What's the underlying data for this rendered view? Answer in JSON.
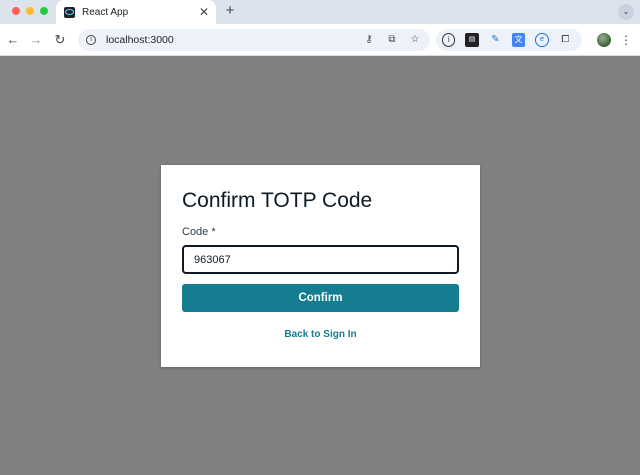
{
  "browser": {
    "tab_title": "React App",
    "tab_close": "✕",
    "new_tab": "+",
    "tab_menu": "⌄",
    "url": "localhost:3000",
    "nav": {
      "back": "←",
      "forward": "→",
      "reload": "↻"
    },
    "omnibox_icons": [
      "key-icon",
      "open-in-app-icon",
      "bookmark-star-icon"
    ],
    "extensions": [
      "info-icon",
      "tab-extension-icon",
      "pen-extension-icon",
      "translate-extension-icon",
      "circle-extension-icon",
      "puzzle-extensions-icon"
    ],
    "menu": "⋮"
  },
  "page": {
    "title": "Confirm TOTP Code",
    "field_label": "Code *",
    "code_value": "963067",
    "confirm_label": "Confirm",
    "back_link": "Back to Sign In"
  },
  "colors": {
    "backdrop": "#808080",
    "accent": "#147d8f",
    "title_text": "#0d1a26"
  }
}
